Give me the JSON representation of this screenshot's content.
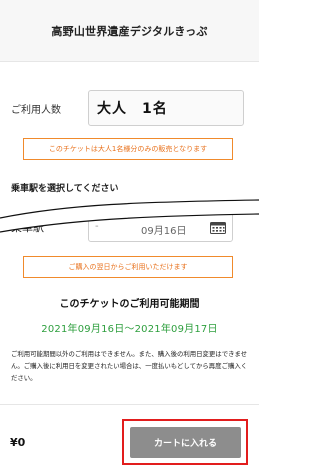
{
  "header": {
    "title": "高野山世界遺産デジタルきっぷ"
  },
  "users": {
    "label": "ご利用人数",
    "value": "大人　1名"
  },
  "notes": {
    "adult_only": "このチケットは大人1名様分のみの販売となります",
    "from_purchase": "ご購入の翌日からご利用いただけます"
  },
  "station": {
    "section_title": "乗車駅を選択してください",
    "label": "乗車駅",
    "field_text": "-",
    "date_text": "09月16日"
  },
  "period": {
    "title": "このチケットのご利用可能期間",
    "range": "2021年09月16日～2021年09月17日"
  },
  "disclaimer": "ご利用可能期間以外のご利用はできません。また、購入後の利用日変更はできません。ご購入後に利用日を変更されたい場合は、一度払いもどしてから再度ご購入ください。",
  "footer": {
    "price": "¥0",
    "cart_label": "カートに入れる"
  },
  "colors": {
    "accent_orange": "#e8711c",
    "period_green": "#2e9f3e",
    "highlight_red": "#e21d1d",
    "button_gray": "#8d8d8d"
  }
}
